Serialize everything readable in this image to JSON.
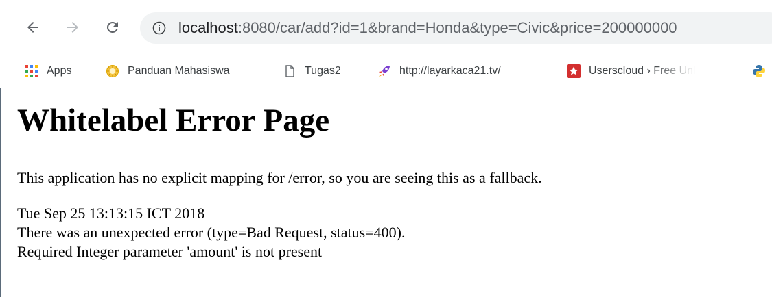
{
  "browser": {
    "url_host": "localhost",
    "url_rest": ":8080/car/add?id=1&brand=Honda&type=Civic&price=200000000",
    "icons": {
      "back": "arrow-left-icon",
      "forward": "arrow-right-icon",
      "reload": "reload-icon",
      "info": "info-circle-icon"
    },
    "bookmarks": [
      {
        "label": "Apps",
        "icon": "apps-grid-icon"
      },
      {
        "label": "Panduan Mahasiswa",
        "icon": "sun-logo-icon"
      },
      {
        "label": "Tugas2",
        "icon": "document-icon"
      },
      {
        "label": "http://layarkaca21.tv/",
        "icon": "rocket-icon"
      },
      {
        "label": "Userscloud › Free Unl",
        "icon": "red-star-icon"
      }
    ]
  },
  "page": {
    "title": "Whitelabel Error Page",
    "description": "This application has no explicit mapping for /error, so you are seeing this as a fallback.",
    "timestamp": "Tue Sep 25 13:13:15 ICT 2018",
    "error_line": "There was an unexpected error (type=Bad Request, status=400).",
    "message": "Required Integer parameter 'amount' is not present"
  }
}
